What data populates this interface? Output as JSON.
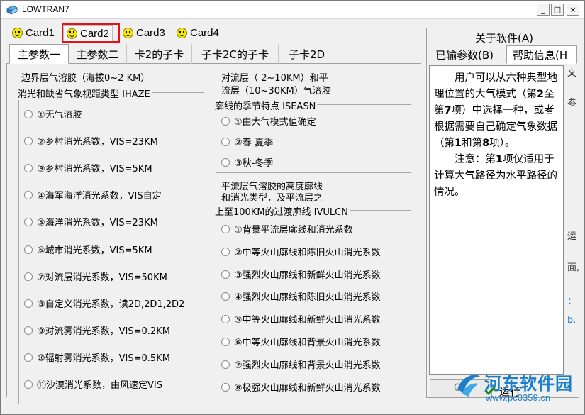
{
  "window": {
    "title": "LOWTRAN7",
    "minimize": "_",
    "maximize": "□",
    "close": "×"
  },
  "card_tabs": [
    "Card1",
    "Card2",
    "Card3",
    "Card4"
  ],
  "sub_tabs": [
    "主参数一",
    "主参数二",
    "卡2的子卡",
    "子卡2C的子卡",
    "子卡2D"
  ],
  "left": {
    "ihaze_heading": "边界层气溶胶（海拔0~2 KM）",
    "ihaze_legend": "消光和缺省气象视距类型 IHAZE",
    "ihaze_options": [
      "①无气溶胶",
      "②乡村消光系数，VIS=23KM",
      "③乡村消光系数，VIS=5KM",
      "④海军海洋消光系数，VIS自定",
      "⑤海洋消光系数，VIS=23KM",
      "⑥城市消光系数，VIS=5KM",
      "⑦对流层消光系数，VIS=50KM",
      "⑧自定义消光系数，读2D,2D1,2D2",
      "⑨对流雾消光系数，VIS=0.2KM",
      "⑩辐射雾消光系数，VIS=0.5KM",
      "⑪沙漠消光系数，由风速定VIS"
    ],
    "iseasn_heading_1": "对流层（ 2~10KM）和平",
    "iseasn_heading_2": "流层（10~30KM）气溶胶",
    "iseasn_legend": "廓线的季节特点 ISEASN",
    "iseasn_options": [
      "①由大气模式值确定",
      "②春-夏季",
      "③秋-冬季"
    ],
    "ivulcn_heading_1": "平流层气溶胶的高度廓线",
    "ivulcn_heading_2": "和消光类型，及平流层之",
    "ivulcn_legend": "上至100KM的过渡廓线 IVULCN",
    "ivulcn_options": [
      "①背景平流层廓线和消光系数",
      "②中等火山廓线和陈旧火山消光系数",
      "③强烈火山廓线和新鲜火山消光系数",
      "④强烈火山廓线和陈旧火山消光系数",
      "⑤中等火山廓线和新鲜火山消光系数",
      "⑥中等火山廓线和背景火山消光系数",
      "⑦强烈火山廓线和背景火山消光系数",
      "⑧极强火山廓线和新鲜火山消光系数"
    ]
  },
  "right": {
    "about": "关于软件(A)",
    "tabs": [
      "已输参数(B)",
      "帮助信息(H"
    ],
    "help_p1_a": "用户可以从六种典型地理位置的大气模式（第",
    "help_p1_b": "2",
    "help_p1_c": "至第",
    "help_p1_d": "7",
    "help_p1_e": "项）中选择一种，或者根据需要自己确定气象数据（第",
    "help_p1_f": "1",
    "help_p1_g": "和第",
    "help_p1_h": "8",
    "help_p1_i": "项）。",
    "help_p2_a": "注意：第",
    "help_p2_b": "1",
    "help_p2_c": "项仅适用于计算大气路径为水平路径的情况。",
    "side_chars": [
      "文",
      "参",
      "运",
      "面,",
      "：",
      "b."
    ],
    "ok_label": "OK",
    "run_label": "运行"
  },
  "watermark": {
    "name": "河东软件园",
    "url": "www.pc0359.cn"
  }
}
